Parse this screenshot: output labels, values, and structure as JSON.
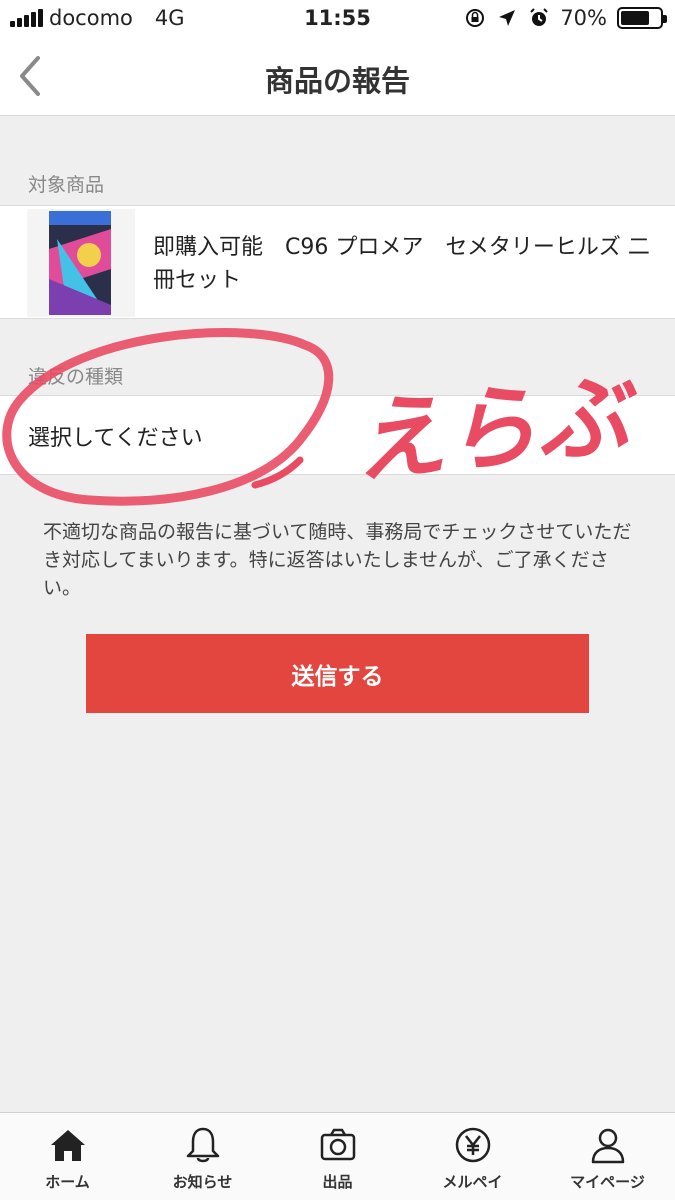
{
  "status_bar": {
    "carrier": "docomo",
    "network": "4G",
    "time": "11:55",
    "battery": "70%",
    "battery_level": 0.7,
    "icons": [
      "orientation-lock-icon",
      "location-icon",
      "alarm-icon",
      "battery-icon"
    ]
  },
  "header": {
    "title": "商品の報告",
    "back_icon": "chevron-left-icon"
  },
  "target_product": {
    "section_label": "対象商品",
    "name": "即購入可能　C96 プロメア　セメタリーヒルズ 二冊セット"
  },
  "violation": {
    "section_label": "違反の種類",
    "placeholder": "選択してください"
  },
  "annotation": {
    "handwritten_text": "えらぶ"
  },
  "notice": "不適切な商品の報告に基づいて随時、事務局でチェックさせていただき対応してまいります。特に返答はいたしませんが、ご了承ください。",
  "submit_label": "送信する",
  "colors": {
    "accent": "#e2463e",
    "annotation": "#e94b63",
    "background": "#efefef"
  },
  "tab_bar": {
    "items": [
      {
        "label": "ホーム",
        "icon": "home-icon"
      },
      {
        "label": "お知らせ",
        "icon": "bell-icon"
      },
      {
        "label": "出品",
        "icon": "camera-icon"
      },
      {
        "label": "メルペイ",
        "icon": "yen-icon"
      },
      {
        "label": "マイページ",
        "icon": "person-icon"
      }
    ]
  }
}
